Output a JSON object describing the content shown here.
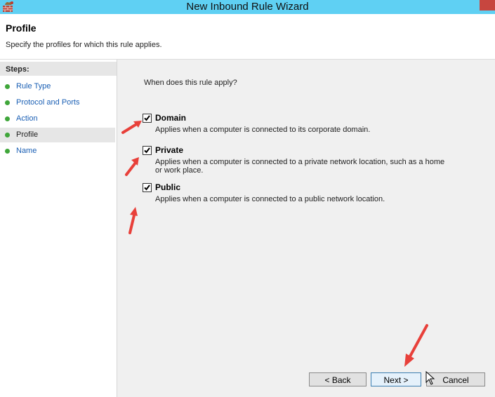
{
  "window": {
    "title": "New Inbound Rule Wizard"
  },
  "header": {
    "title": "Profile",
    "subtitle": "Specify the profiles for which this rule applies."
  },
  "sidebar": {
    "header": "Steps:",
    "items": [
      {
        "label": "Rule Type",
        "active": false
      },
      {
        "label": "Protocol and Ports",
        "active": false
      },
      {
        "label": "Action",
        "active": false
      },
      {
        "label": "Profile",
        "active": true
      },
      {
        "label": "Name",
        "active": false
      }
    ]
  },
  "main": {
    "question": "When does this rule apply?",
    "options": [
      {
        "label": "Domain",
        "checked": true,
        "description": "Applies when a computer is connected to its corporate domain."
      },
      {
        "label": "Private",
        "checked": true,
        "description": "Applies when a computer is connected to a private network location, such as a home or work place."
      },
      {
        "label": "Public",
        "checked": true,
        "description": "Applies when a computer is connected to a public network location."
      }
    ]
  },
  "buttons": {
    "back": "< Back",
    "next": "Next >",
    "cancel": "Cancel"
  },
  "colors": {
    "titlebar": "#5fd0f3",
    "step_dot": "#3fa63a",
    "step_link": "#1a5fb4",
    "annotation_arrow": "#e8403a"
  }
}
